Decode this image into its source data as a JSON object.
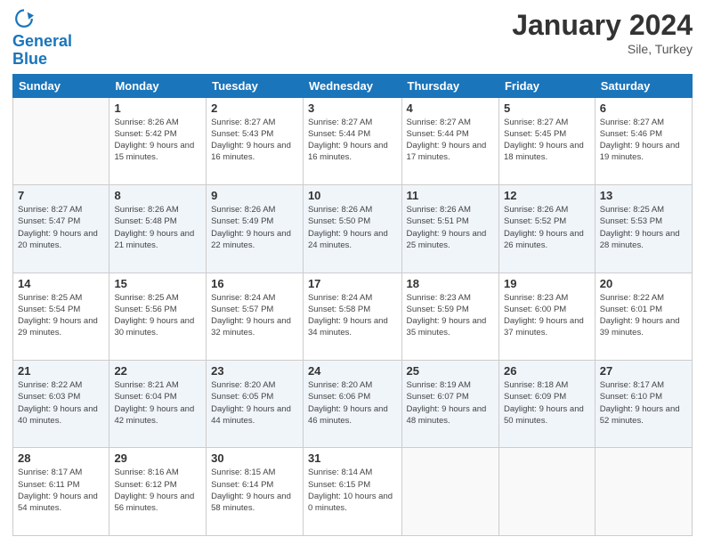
{
  "logo": {
    "line1": "General",
    "line2": "Blue"
  },
  "title": "January 2024",
  "location": "Sile, Turkey",
  "days_of_week": [
    "Sunday",
    "Monday",
    "Tuesday",
    "Wednesday",
    "Thursday",
    "Friday",
    "Saturday"
  ],
  "weeks": [
    [
      {
        "day": "",
        "sunrise": "",
        "sunset": "",
        "daylight": ""
      },
      {
        "day": "1",
        "sunrise": "Sunrise: 8:26 AM",
        "sunset": "Sunset: 5:42 PM",
        "daylight": "Daylight: 9 hours and 15 minutes."
      },
      {
        "day": "2",
        "sunrise": "Sunrise: 8:27 AM",
        "sunset": "Sunset: 5:43 PM",
        "daylight": "Daylight: 9 hours and 16 minutes."
      },
      {
        "day": "3",
        "sunrise": "Sunrise: 8:27 AM",
        "sunset": "Sunset: 5:44 PM",
        "daylight": "Daylight: 9 hours and 16 minutes."
      },
      {
        "day": "4",
        "sunrise": "Sunrise: 8:27 AM",
        "sunset": "Sunset: 5:44 PM",
        "daylight": "Daylight: 9 hours and 17 minutes."
      },
      {
        "day": "5",
        "sunrise": "Sunrise: 8:27 AM",
        "sunset": "Sunset: 5:45 PM",
        "daylight": "Daylight: 9 hours and 18 minutes."
      },
      {
        "day": "6",
        "sunrise": "Sunrise: 8:27 AM",
        "sunset": "Sunset: 5:46 PM",
        "daylight": "Daylight: 9 hours and 19 minutes."
      }
    ],
    [
      {
        "day": "7",
        "sunrise": "Sunrise: 8:27 AM",
        "sunset": "Sunset: 5:47 PM",
        "daylight": "Daylight: 9 hours and 20 minutes."
      },
      {
        "day": "8",
        "sunrise": "Sunrise: 8:26 AM",
        "sunset": "Sunset: 5:48 PM",
        "daylight": "Daylight: 9 hours and 21 minutes."
      },
      {
        "day": "9",
        "sunrise": "Sunrise: 8:26 AM",
        "sunset": "Sunset: 5:49 PM",
        "daylight": "Daylight: 9 hours and 22 minutes."
      },
      {
        "day": "10",
        "sunrise": "Sunrise: 8:26 AM",
        "sunset": "Sunset: 5:50 PM",
        "daylight": "Daylight: 9 hours and 24 minutes."
      },
      {
        "day": "11",
        "sunrise": "Sunrise: 8:26 AM",
        "sunset": "Sunset: 5:51 PM",
        "daylight": "Daylight: 9 hours and 25 minutes."
      },
      {
        "day": "12",
        "sunrise": "Sunrise: 8:26 AM",
        "sunset": "Sunset: 5:52 PM",
        "daylight": "Daylight: 9 hours and 26 minutes."
      },
      {
        "day": "13",
        "sunrise": "Sunrise: 8:25 AM",
        "sunset": "Sunset: 5:53 PM",
        "daylight": "Daylight: 9 hours and 28 minutes."
      }
    ],
    [
      {
        "day": "14",
        "sunrise": "Sunrise: 8:25 AM",
        "sunset": "Sunset: 5:54 PM",
        "daylight": "Daylight: 9 hours and 29 minutes."
      },
      {
        "day": "15",
        "sunrise": "Sunrise: 8:25 AM",
        "sunset": "Sunset: 5:56 PM",
        "daylight": "Daylight: 9 hours and 30 minutes."
      },
      {
        "day": "16",
        "sunrise": "Sunrise: 8:24 AM",
        "sunset": "Sunset: 5:57 PM",
        "daylight": "Daylight: 9 hours and 32 minutes."
      },
      {
        "day": "17",
        "sunrise": "Sunrise: 8:24 AM",
        "sunset": "Sunset: 5:58 PM",
        "daylight": "Daylight: 9 hours and 34 minutes."
      },
      {
        "day": "18",
        "sunrise": "Sunrise: 8:23 AM",
        "sunset": "Sunset: 5:59 PM",
        "daylight": "Daylight: 9 hours and 35 minutes."
      },
      {
        "day": "19",
        "sunrise": "Sunrise: 8:23 AM",
        "sunset": "Sunset: 6:00 PM",
        "daylight": "Daylight: 9 hours and 37 minutes."
      },
      {
        "day": "20",
        "sunrise": "Sunrise: 8:22 AM",
        "sunset": "Sunset: 6:01 PM",
        "daylight": "Daylight: 9 hours and 39 minutes."
      }
    ],
    [
      {
        "day": "21",
        "sunrise": "Sunrise: 8:22 AM",
        "sunset": "Sunset: 6:03 PM",
        "daylight": "Daylight: 9 hours and 40 minutes."
      },
      {
        "day": "22",
        "sunrise": "Sunrise: 8:21 AM",
        "sunset": "Sunset: 6:04 PM",
        "daylight": "Daylight: 9 hours and 42 minutes."
      },
      {
        "day": "23",
        "sunrise": "Sunrise: 8:20 AM",
        "sunset": "Sunset: 6:05 PM",
        "daylight": "Daylight: 9 hours and 44 minutes."
      },
      {
        "day": "24",
        "sunrise": "Sunrise: 8:20 AM",
        "sunset": "Sunset: 6:06 PM",
        "daylight": "Daylight: 9 hours and 46 minutes."
      },
      {
        "day": "25",
        "sunrise": "Sunrise: 8:19 AM",
        "sunset": "Sunset: 6:07 PM",
        "daylight": "Daylight: 9 hours and 48 minutes."
      },
      {
        "day": "26",
        "sunrise": "Sunrise: 8:18 AM",
        "sunset": "Sunset: 6:09 PM",
        "daylight": "Daylight: 9 hours and 50 minutes."
      },
      {
        "day": "27",
        "sunrise": "Sunrise: 8:17 AM",
        "sunset": "Sunset: 6:10 PM",
        "daylight": "Daylight: 9 hours and 52 minutes."
      }
    ],
    [
      {
        "day": "28",
        "sunrise": "Sunrise: 8:17 AM",
        "sunset": "Sunset: 6:11 PM",
        "daylight": "Daylight: 9 hours and 54 minutes."
      },
      {
        "day": "29",
        "sunrise": "Sunrise: 8:16 AM",
        "sunset": "Sunset: 6:12 PM",
        "daylight": "Daylight: 9 hours and 56 minutes."
      },
      {
        "day": "30",
        "sunrise": "Sunrise: 8:15 AM",
        "sunset": "Sunset: 6:14 PM",
        "daylight": "Daylight: 9 hours and 58 minutes."
      },
      {
        "day": "31",
        "sunrise": "Sunrise: 8:14 AM",
        "sunset": "Sunset: 6:15 PM",
        "daylight": "Daylight: 10 hours and 0 minutes."
      },
      {
        "day": "",
        "sunrise": "",
        "sunset": "",
        "daylight": ""
      },
      {
        "day": "",
        "sunrise": "",
        "sunset": "",
        "daylight": ""
      },
      {
        "day": "",
        "sunrise": "",
        "sunset": "",
        "daylight": ""
      }
    ]
  ]
}
